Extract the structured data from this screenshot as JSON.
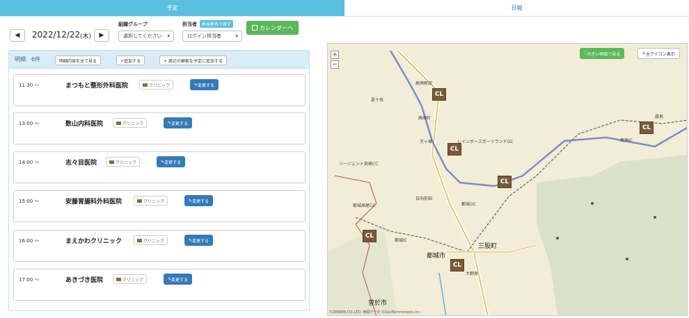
{
  "tabs": [
    {
      "label": "予定"
    },
    {
      "label": "日報"
    }
  ],
  "controls": {
    "prev_icon": "◀",
    "next_icon": "▶",
    "date": "2022/12/22",
    "weekday": "(木)",
    "group_label": "組織グループ",
    "group_select": "選択してください",
    "owner_label": "担当者",
    "owner_search_badge": "担当者名で探す",
    "owner_select": "ログイン担当者",
    "calendar_button": "カレンダーへ"
  },
  "list": {
    "title": "明細",
    "count": "6件",
    "buttons": {
      "view_all": "明細内容を全て見る",
      "add": "+追加する",
      "add_nearby": "+ 周辺の顧客を予定に追加する"
    },
    "items": [
      {
        "time": "11:30 〜",
        "name": "まつもと整形外科医院",
        "tag": "クリニック",
        "edit": "変更する"
      },
      {
        "time": "13:00 〜",
        "name": "数山内科医院",
        "tag": "クリニック",
        "edit": "変更する"
      },
      {
        "time": "14:00 〜",
        "name": "志々目医院",
        "tag": "クリニック",
        "edit": "変更する"
      },
      {
        "time": "15:00 〜",
        "name": "安藤胃腸科外科医院",
        "tag": "クリニック",
        "edit": "変更する"
      },
      {
        "time": "16:00 〜",
        "name": "まえかわクリニック",
        "tag": "クリニック",
        "edit": "変更する"
      },
      {
        "time": "17:00 〜",
        "name": "あきづき医院",
        "tag": "クリニック",
        "edit": "変更する"
      }
    ]
  },
  "map": {
    "big_map_button": "大きい地図で見る",
    "all_icons_button": "全アイコン表示",
    "zoom_in": "+",
    "zoom_out": "−",
    "marker_label": "CL",
    "labels": [
      {
        "text": "高崎新田"
      },
      {
        "text": "夏ケ岳"
      },
      {
        "text": "高崎町"
      },
      {
        "text": "万ヶ塚"
      },
      {
        "text": "レインボースポーツランドGC"
      },
      {
        "text": "リージェント宮崎CC"
      },
      {
        "text": "都城GC"
      },
      {
        "text": "都城高尾CC"
      },
      {
        "text": "日向前田"
      },
      {
        "text": "都城IC"
      },
      {
        "text": "三股町"
      },
      {
        "text": "都城市"
      },
      {
        "text": "曽於市"
      },
      {
        "text": "高原IC"
      },
      {
        "text": "霧島"
      },
      {
        "text": "大野原"
      }
    ],
    "copyright": "©ZENRIN CO.,LTD. 地図データ ©GeoTechnologies,Inc."
  },
  "colors": {
    "tab_active": "#5bc0de",
    "calendar_green": "#5cb85c",
    "edit_blue": "#337ab7",
    "marker_brown": "#7a5a3a"
  }
}
